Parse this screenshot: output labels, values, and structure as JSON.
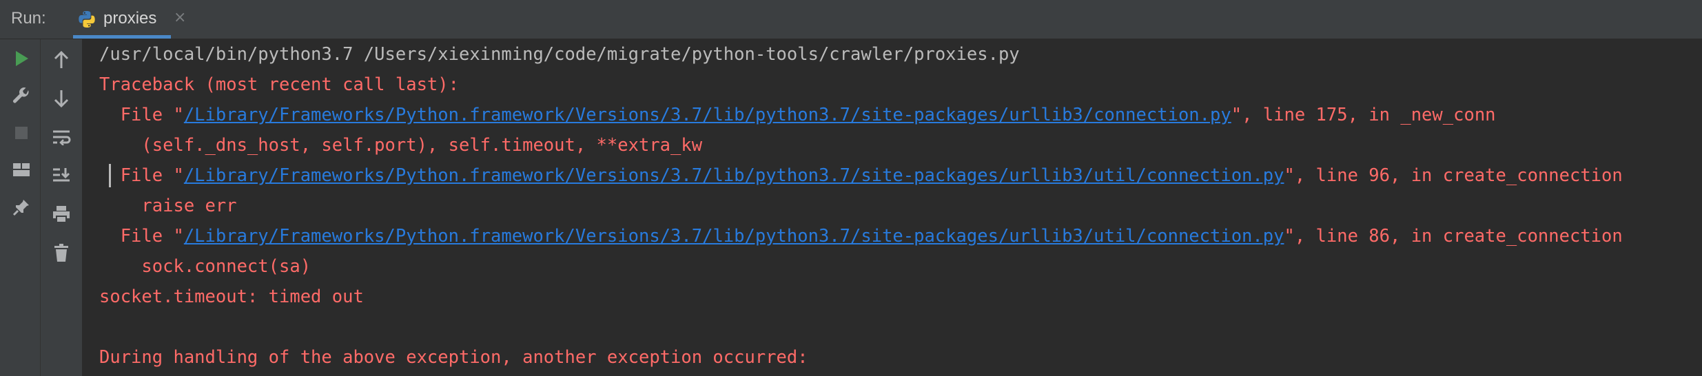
{
  "header": {
    "run_label": "Run:",
    "tab": {
      "label": "proxies",
      "close": "×",
      "icon": "python-icon"
    }
  },
  "toolbar_left": [
    "run-icon",
    "wrench-icon",
    "stop-icon",
    "layout-icon",
    "pin-icon"
  ],
  "toolbar_right": [
    "arrow-up-icon",
    "arrow-down-icon",
    "soft-wrap-icon",
    "scroll-to-end-icon",
    "print-icon",
    "trash-icon"
  ],
  "colors": {
    "error": "#ff6b68",
    "link": "#287bde",
    "plain": "#bbbbbb",
    "background": "#2b2b2b",
    "accent": "#4a88c7"
  },
  "console": {
    "lines": [
      {
        "text": "/usr/local/bin/python3.7 /Users/xiexinming/code/migrate/python-tools/crawler/proxies.py"
      },
      {
        "text": "Traceback (most recent call last):"
      },
      {
        "pre": "  File \"",
        "link": "/Library/Frameworks/Python.framework/Versions/3.7/lib/python3.7/site-packages/urllib3/connection.py",
        "post": "\", line 175, in _new_conn"
      },
      {
        "text": "    (self._dns_host, self.port), self.timeout, **extra_kw"
      },
      {
        "pre": "  File \"",
        "link": "/Library/Frameworks/Python.framework/Versions/3.7/lib/python3.7/site-packages/urllib3/util/connection.py",
        "post": "\", line 96, in create_connection"
      },
      {
        "text": "    raise err"
      },
      {
        "pre": "  File \"",
        "link": "/Library/Frameworks/Python.framework/Versions/3.7/lib/python3.7/site-packages/urllib3/util/connection.py",
        "post": "\", line 86, in create_connection"
      },
      {
        "text": "    sock.connect(sa)"
      },
      {
        "text": "socket.timeout: timed out"
      },
      {
        "text": ""
      },
      {
        "text": "During handling of the above exception, another exception occurred:"
      }
    ]
  }
}
